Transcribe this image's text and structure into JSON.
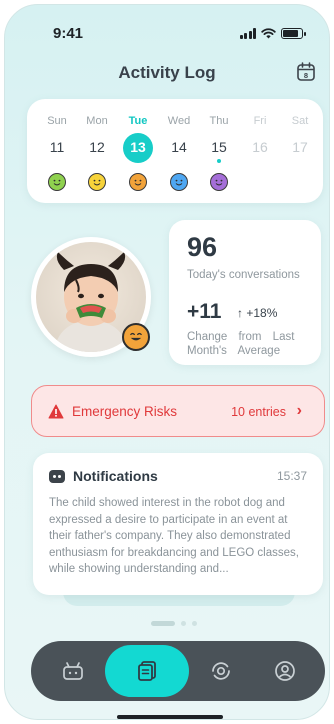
{
  "status_bar": {
    "time": "9:41"
  },
  "header": {
    "title": "Activity Log",
    "calendar_badge": "8"
  },
  "week": {
    "days": [
      {
        "name": "Sun",
        "num": "11",
        "mood": "#8fd14f"
      },
      {
        "name": "Mon",
        "num": "12",
        "mood": "#f7d33a"
      },
      {
        "name": "Tue",
        "num": "13",
        "mood": "#f2a33a"
      },
      {
        "name": "Wed",
        "num": "14",
        "mood": "#4ea7f2"
      },
      {
        "name": "Thu",
        "num": "15",
        "mood": "#a56ed8"
      },
      {
        "name": "Fri",
        "num": "16"
      },
      {
        "name": "Sat",
        "num": "17"
      }
    ],
    "selected_index": 2
  },
  "stats": {
    "conversations": "96",
    "conversations_label": "Today's conversations",
    "change": "+11",
    "change_pct": "+18%",
    "change_label": "Change from Last Month's Average"
  },
  "alert": {
    "label": "Emergency Risks",
    "count": "10 entries",
    "color": "#e0393b"
  },
  "notifications": {
    "title": "Notifications",
    "time": "15:37",
    "body": "The child showed interest in the robot dog and expressed a desire to participate in an event at their father's company. They also demonstrated enthusiasm for breakdancing and LEGO classes, while showing understanding and..."
  },
  "tabs": [
    {
      "name": "robot-icon"
    },
    {
      "name": "activity-log-icon",
      "active": true
    },
    {
      "name": "camera-rotate-icon"
    },
    {
      "name": "profile-icon"
    }
  ],
  "colors": {
    "accent": "#13d9d2",
    "tabbar": "#4a5258"
  }
}
